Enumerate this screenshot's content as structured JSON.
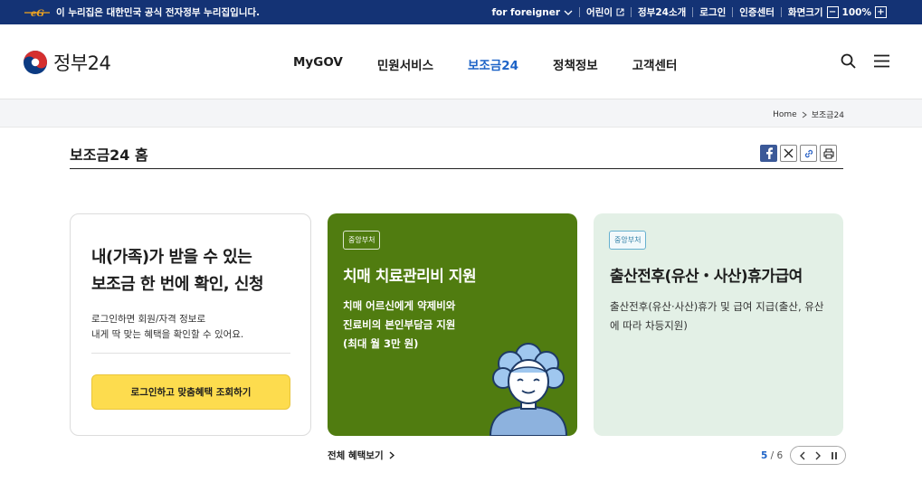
{
  "topbar": {
    "notice": "이 누리집은 대한민국 공식 전자정부 누리집입니다.",
    "foreigner": "for foreigner",
    "kids": "어린이",
    "about": "정부24소개",
    "login": "로그인",
    "cert": "인증센터",
    "fontsize": "화면크기",
    "zoom": "100%",
    "zoom_minus": "−",
    "zoom_plus": "+"
  },
  "header": {
    "brand": "정부24",
    "menu": [
      "MyGOV",
      "민원서비스",
      "보조금24",
      "정책정보",
      "고객센터"
    ],
    "active_menu": "보조금24"
  },
  "breadcrumb": {
    "home": "Home",
    "current": "보조금24"
  },
  "page": {
    "title": "보조금24 홈"
  },
  "login_card": {
    "heading_line1": "내(가족)가 받을 수 있는",
    "heading_line2": "보조금 한 번에 확인, 신청",
    "desc_line1": "로그인하면 회원/자격 정보로",
    "desc_line2": "내게 딱 맞는 혜택을 확인할 수 있어요.",
    "button": "로그인하고 맞춤혜택 조회하기"
  },
  "benefit_cards": [
    {
      "tag": "중앙부처",
      "title": "치매 치료관리비 지원",
      "desc_line1": "치매 어르신에게 약제비와",
      "desc_line2": "진료비의 본인부담금 지원",
      "desc_line3": "(최대 월 3만 원)"
    },
    {
      "tag": "중앙부처",
      "title": "출산전후(유산・사산)휴가급여",
      "desc": "출산전후(유산·사산)휴가 및 급여 지급(출산, 유산에 따라 차등지원)"
    }
  ],
  "all_benefits": "전체 혜택보기",
  "pager": {
    "current": "5",
    "total": "6",
    "separator": "/"
  },
  "colors": {
    "topbar": "#143375",
    "active_menu": "#1d63c7",
    "green_card": "#507c10",
    "mint_card": "#e3f0e6",
    "login_button": "#fddc4e"
  }
}
